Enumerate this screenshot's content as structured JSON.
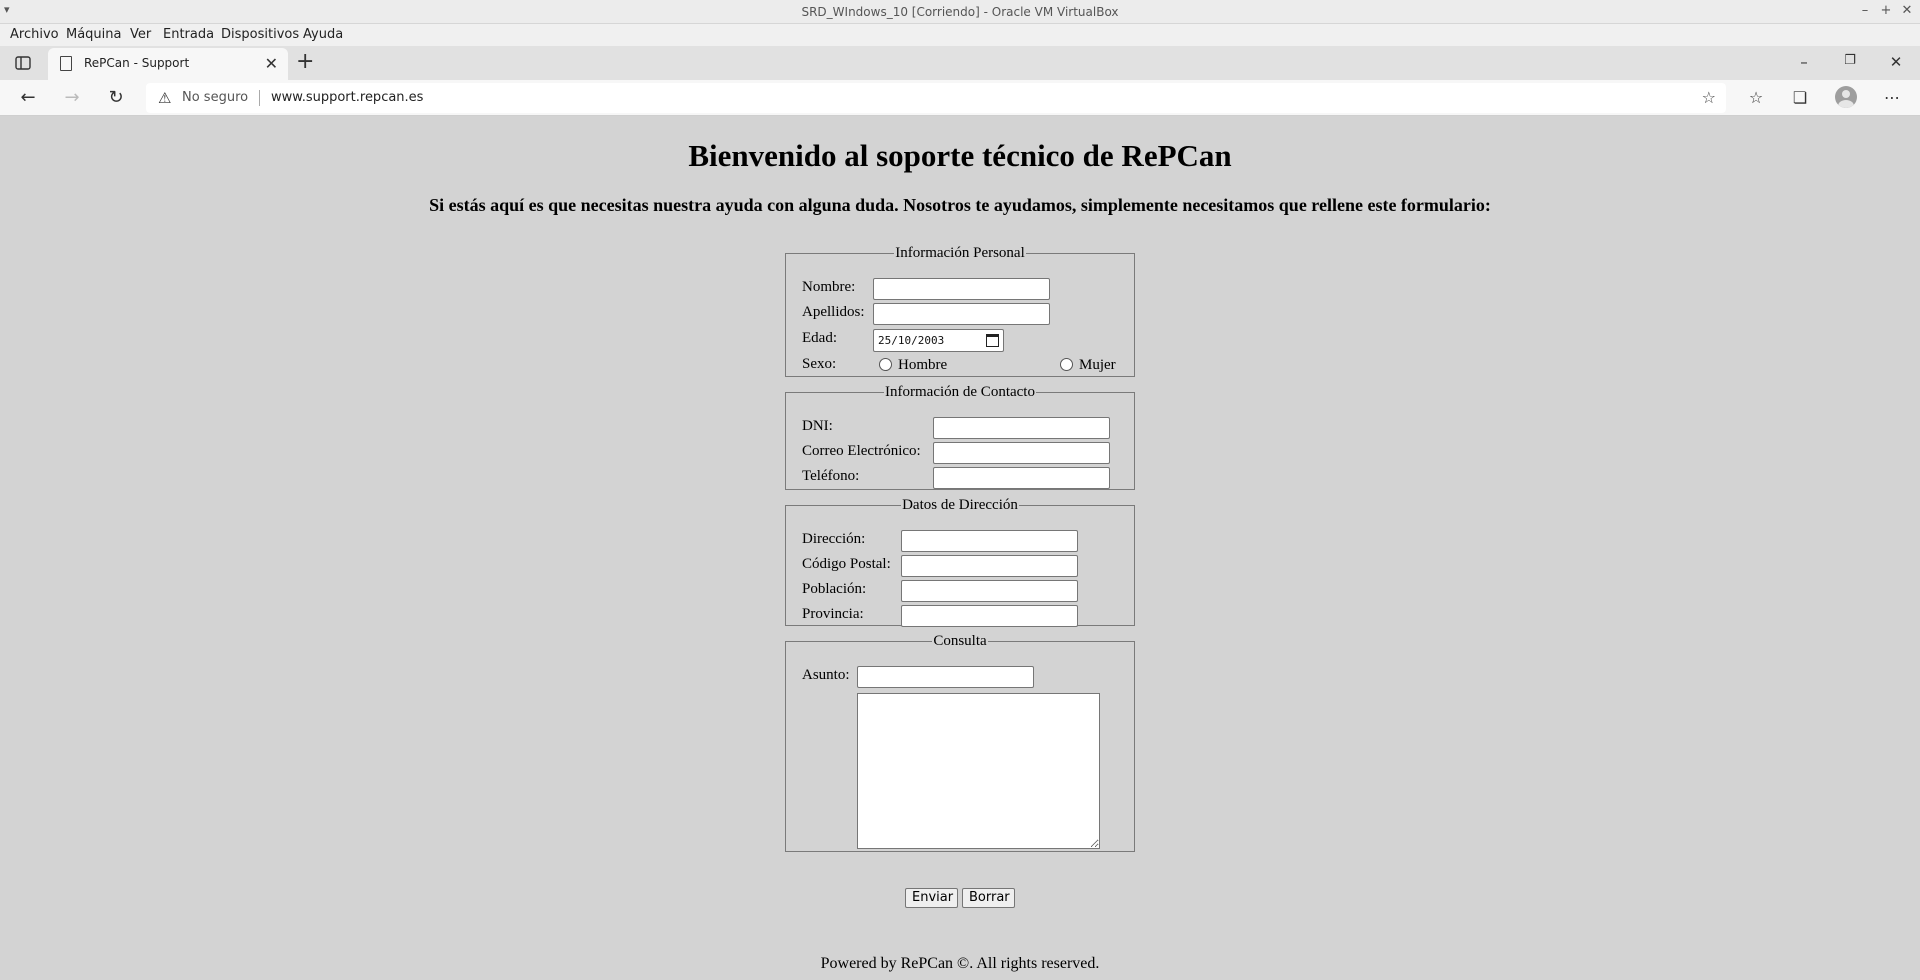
{
  "vm": {
    "title": "SRD_WIndows_10 [Corriendo] - Oracle VM VirtualBox",
    "menu": [
      "Archivo",
      "Máquina",
      "Ver",
      "Entrada",
      "Dispositivos",
      "Ayuda"
    ]
  },
  "browser": {
    "tab_title": "RePCan - Support",
    "security_label": "No seguro",
    "url": "www.support.repcan.es"
  },
  "page": {
    "heading": "Bienvenido al soporte técnico de RePCan",
    "intro": "Si estás aquí es que necesitas nuestra ayuda con alguna duda. Nosotros te ayudamos, simplemente necesitamos que rellene este formulario:",
    "personal": {
      "legend": "Información Personal",
      "nombre_label": "Nombre:",
      "apellidos_label": "Apellidos:",
      "edad_label": "Edad:",
      "edad_value": "25/10/2003",
      "sexo_label": "Sexo:",
      "hombre_label": "Hombre",
      "mujer_label": "Mujer"
    },
    "contact": {
      "legend": "Información de Contacto",
      "dni_label": "DNI:",
      "email_label": "Correo Electrónico:",
      "phone_label": "Teléfono:"
    },
    "address": {
      "legend": "Datos de Dirección",
      "direccion_label": "Dirección:",
      "cp_label": "Código Postal:",
      "poblacion_label": "Población:",
      "provincia_label": "Provincia:"
    },
    "query": {
      "legend": "Consulta",
      "asunto_label": "Asunto:"
    },
    "buttons": {
      "send": "Enviar",
      "clear": "Borrar"
    },
    "footer": "Powered by RePCan ©. All rights reserved."
  }
}
